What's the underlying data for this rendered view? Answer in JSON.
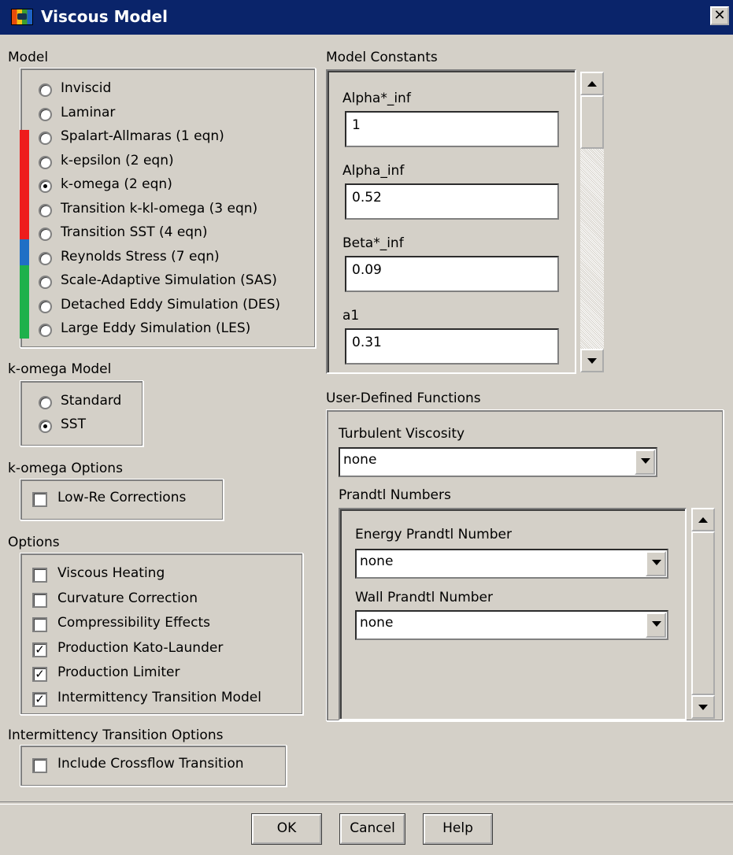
{
  "window": {
    "title": "Viscous Model",
    "close_label": "✕"
  },
  "model": {
    "label": "Model",
    "options": [
      {
        "label": "Inviscid",
        "selected": false
      },
      {
        "label": "Laminar",
        "selected": false
      },
      {
        "label": "Spalart-Allmaras (1 eqn)",
        "selected": false
      },
      {
        "label": "k-epsilon (2 eqn)",
        "selected": false
      },
      {
        "label": "k-omega (2 eqn)",
        "selected": true
      },
      {
        "label": "Transition k-kl-omega (3 eqn)",
        "selected": false
      },
      {
        "label": "Transition SST (4 eqn)",
        "selected": false
      },
      {
        "label": "Reynolds Stress (7 eqn)",
        "selected": false
      },
      {
        "label": "Scale-Adaptive Simulation (SAS)",
        "selected": false
      },
      {
        "label": "Detached Eddy Simulation (DES)",
        "selected": false
      },
      {
        "label": "Large Eddy Simulation (LES)",
        "selected": false
      }
    ],
    "marker_colors": {
      "red": "#ee1c1c",
      "blue": "#1f6fc5",
      "green": "#1db14b"
    }
  },
  "komega_model": {
    "label": "k-omega Model",
    "options": [
      {
        "label": "Standard",
        "selected": false
      },
      {
        "label": "SST",
        "selected": true
      }
    ]
  },
  "komega_options": {
    "label": "k-omega Options",
    "items": [
      {
        "label": "Low-Re Corrections",
        "checked": false
      }
    ]
  },
  "options": {
    "label": "Options",
    "items": [
      {
        "label": "Viscous Heating",
        "checked": false
      },
      {
        "label": "Curvature Correction",
        "checked": false
      },
      {
        "label": "Compressibility Effects",
        "checked": false
      },
      {
        "label": "Production Kato-Launder",
        "checked": true
      },
      {
        "label": "Production Limiter",
        "checked": true
      },
      {
        "label": "Intermittency Transition Model",
        "checked": true
      }
    ]
  },
  "intermittency": {
    "label": "Intermittency Transition Options",
    "items": [
      {
        "label": "Include Crossflow Transition",
        "checked": false
      }
    ]
  },
  "constants": {
    "label": "Model Constants",
    "fields": [
      {
        "label": "Alpha*_inf",
        "value": "1"
      },
      {
        "label": "Alpha_inf",
        "value": "0.52"
      },
      {
        "label": "Beta*_inf",
        "value": "0.09"
      },
      {
        "label": "a1",
        "value": "0.31"
      }
    ]
  },
  "udf": {
    "label": "User-Defined Functions",
    "turbulent_viscosity": {
      "label": "Turbulent Viscosity",
      "value": "none"
    },
    "prandtl": {
      "label": "Prandtl Numbers",
      "energy": {
        "label": "Energy Prandtl Number",
        "value": "none"
      },
      "wall": {
        "label": "Wall Prandtl Number",
        "value": "none"
      }
    }
  },
  "buttons": {
    "ok": "OK",
    "cancel": "Cancel",
    "help": "Help"
  }
}
